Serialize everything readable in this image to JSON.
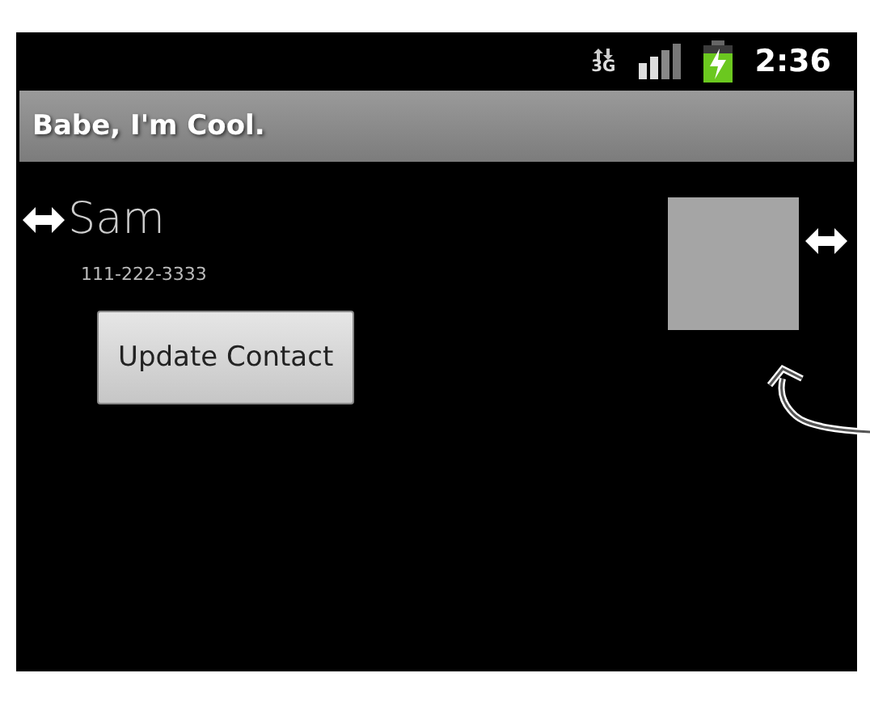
{
  "status_bar": {
    "network": "3G",
    "time": "2:36"
  },
  "title_bar": {
    "title": "Babe, I'm Cool."
  },
  "contact": {
    "name": "Sam",
    "phone": "111-222-3333"
  },
  "buttons": [
    "Update Contact"
  ]
}
